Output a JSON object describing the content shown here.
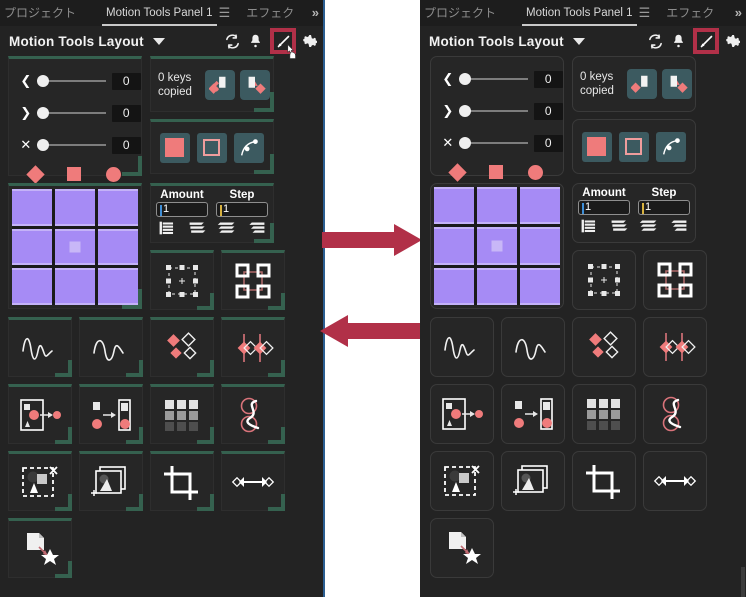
{
  "window": {
    "background": "#ffffff",
    "panel_bg": "#232323",
    "accent_green": "#35614f",
    "accent_red": "#b13048",
    "highlight_blue": "#2c5f92"
  },
  "tabs": {
    "project_label": "プロジェクト",
    "active_label": "Motion Tools Panel 1",
    "menu_icon": "hamburger-icon",
    "effects_label": "エフェク",
    "overflow_icon": "chevron-double-right-icon"
  },
  "header": {
    "title": "Motion Tools Layout",
    "caret_icon": "chevron-down-icon",
    "icons": [
      {
        "name": "refresh-icon",
        "label": "Refresh"
      },
      {
        "name": "bell-icon",
        "label": "Notifications"
      },
      {
        "name": "pencil-icon",
        "label": "Edit Layout",
        "highlighted": true
      },
      {
        "name": "gear-icon",
        "label": "Settings"
      }
    ]
  },
  "sliders": {
    "rows": [
      {
        "icon": "chevron-left-icon",
        "value": "0"
      },
      {
        "icon": "chevron-right-icon",
        "value": "0"
      },
      {
        "icon": "close-x-icon",
        "value": "0"
      }
    ],
    "shapes": [
      "diamond-shape",
      "square-shape",
      "circle-shape"
    ]
  },
  "keys": {
    "status": "0 keys\ncopied",
    "status_line1": "0 keys",
    "status_line2": "copied",
    "buttons": [
      {
        "name": "copy-keys-button"
      },
      {
        "name": "paste-keys-button"
      }
    ]
  },
  "shape_tools": [
    {
      "name": "fill-shape-button"
    },
    {
      "name": "stroke-shape-button"
    },
    {
      "name": "curve-path-button"
    }
  ],
  "anchor_grid": {
    "name": "anchor-point-grid",
    "rows": 3,
    "cols": 3,
    "selected_index": 4,
    "cell_color": "#a68bf5"
  },
  "amount_step": {
    "amount_label": "Amount",
    "step_label": "Step",
    "amount_value": "1",
    "step_value": "1",
    "align_icons": [
      "align-left-icon",
      "align-stagger-left-icon",
      "align-stagger-right-icon",
      "align-right-icon"
    ]
  },
  "tool_cells": [
    {
      "name": "transform-box-tool",
      "row": 0
    },
    {
      "name": "four-corners-tool",
      "row": 0
    },
    {
      "name": "wave-graph-tool",
      "row": 1
    },
    {
      "name": "arc-graph-tool",
      "row": 1
    },
    {
      "name": "scatter-keys-tool",
      "row": 1
    },
    {
      "name": "split-keys-tool",
      "row": 1
    },
    {
      "name": "motion-path-tool",
      "row": 2
    },
    {
      "name": "transfer-motion-tool",
      "row": 2
    },
    {
      "name": "grid-fade-tool",
      "row": 2
    },
    {
      "name": "loop-path-tool",
      "row": 2
    },
    {
      "name": "delete-selection-tool",
      "row": 3
    },
    {
      "name": "duplicate-layer-tool",
      "row": 3
    },
    {
      "name": "crop-tool",
      "row": 3
    },
    {
      "name": "distribute-tool",
      "row": 3
    },
    {
      "name": "apply-preset-tool",
      "row": 4
    }
  ],
  "arrows": [
    {
      "name": "arrow-right",
      "direction": "right",
      "color": "#b13048"
    },
    {
      "name": "arrow-left",
      "direction": "left",
      "color": "#b13048"
    }
  ]
}
